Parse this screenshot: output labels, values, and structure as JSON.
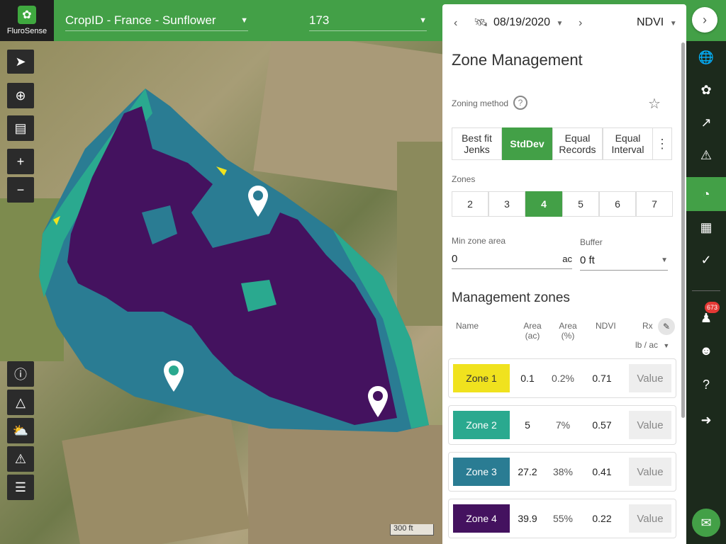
{
  "app": {
    "logo_text": "FluroSense"
  },
  "header": {
    "field_select": "CropID - France - Sunflower",
    "field_value": "173"
  },
  "map": {
    "scale_label": "300 ft",
    "tools": [
      "navigate-icon",
      "locate-icon",
      "ruler-icon",
      "zoom-in-icon",
      "zoom-out-icon"
    ],
    "bottom_tools": [
      "info-icon",
      "draw-polygon-icon",
      "weather-icon",
      "warning-icon",
      "layers-icon"
    ]
  },
  "panel": {
    "date": "08/19/2020",
    "layer": "NDVI",
    "title": "Zone Management",
    "zoning_method_label": "Zoning method",
    "methods": [
      {
        "label": "Best fit Jenks",
        "active": false
      },
      {
        "label": "StdDev",
        "active": true
      },
      {
        "label": "Equal Records",
        "active": false
      },
      {
        "label": "Equal Interval",
        "active": false
      }
    ],
    "zones_label": "Zones",
    "zones": [
      "2",
      "3",
      "4",
      "5",
      "6",
      "7"
    ],
    "zones_active": "4",
    "min_zone_area_label": "Min zone area",
    "min_zone_area_value": "0",
    "min_zone_area_unit": "ac",
    "buffer_label": "Buffer",
    "buffer_value": "0 ft",
    "mgmt_title": "Management zones",
    "columns": {
      "name": "Name",
      "area_ac": "Area (ac)",
      "area_pct": "Area (%)",
      "ndvi": "NDVI",
      "rx": "Rx",
      "rx_unit": "lb / ac"
    },
    "rows": [
      {
        "name": "Zone 1",
        "area": "0.1",
        "pct": "0.2%",
        "ndvi": "0.71",
        "value": "Value",
        "color": "#f0e21e",
        "text": "#333"
      },
      {
        "name": "Zone 2",
        "area": "5",
        "pct": "7%",
        "ndvi": "0.57",
        "value": "Value",
        "color": "#2aa98f",
        "text": "#fff"
      },
      {
        "name": "Zone 3",
        "area": "27.2",
        "pct": "38%",
        "ndvi": "0.41",
        "value": "Value",
        "color": "#2a7c93",
        "text": "#fff"
      },
      {
        "name": "Zone 4",
        "area": "39.9",
        "pct": "55%",
        "ndvi": "0.22",
        "value": "Value",
        "color": "#44125f",
        "text": "#fff"
      }
    ]
  },
  "rightbar": {
    "badge_count": "673"
  },
  "colors": {
    "brand_green": "#43a047",
    "zone_purple": "#44125f",
    "zone_blue": "#2a7c93",
    "zone_teal": "#2aa98f",
    "zone_yellow": "#f0e21e"
  }
}
